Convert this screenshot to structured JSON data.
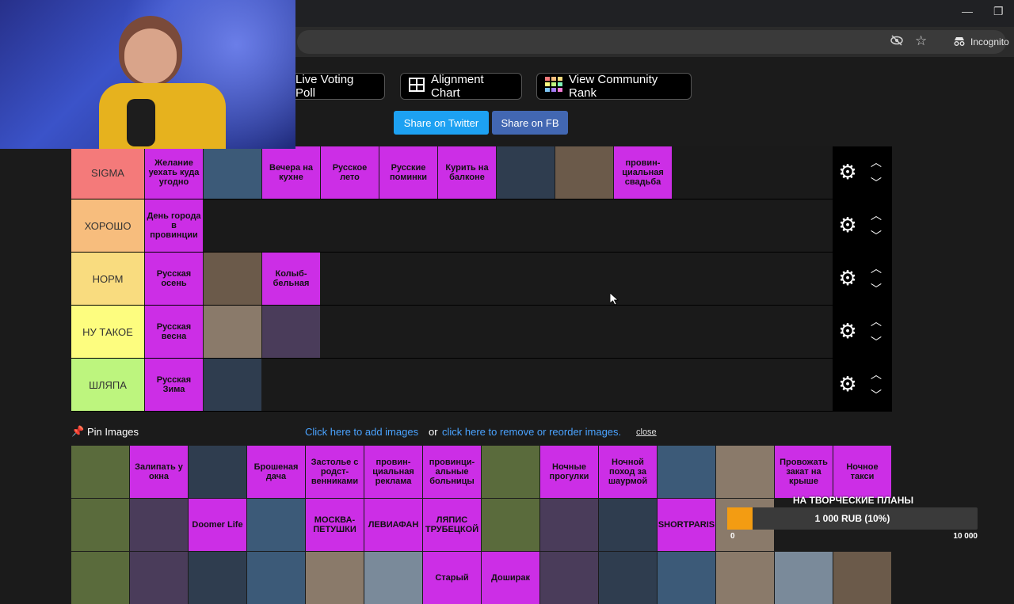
{
  "browser": {
    "incognito_label": "Incognito",
    "window_controls": [
      "—",
      "❐"
    ]
  },
  "toolbar": {
    "buttons": [
      {
        "label": "Live Voting Poll",
        "icon": "poll-icon"
      },
      {
        "label": "Alignment Chart",
        "icon": "grid-icon"
      },
      {
        "label": "View Community Rank",
        "icon": "rank-icon"
      }
    ],
    "share_twitter": "Share on Twitter",
    "share_fb": "Share on FB",
    "colors": {
      "twitter": "#1da1f2",
      "fb": "#4267b2"
    }
  },
  "tiers": [
    {
      "label": "SIGMA",
      "color": "#f47a7a",
      "items": [
        "Желание уехать куда угодно",
        "",
        "Вечера на кухне",
        "Русское лето",
        "Русские поминки",
        "Курить на балконе",
        "",
        "",
        "провин-циальная свадьба"
      ]
    },
    {
      "label": "ХОРОШО",
      "color": "#f7bd7d",
      "items": [
        "День города в провинции"
      ]
    },
    {
      "label": "НОРМ",
      "color": "#f9dc7f",
      "items": [
        "Русская осень",
        "",
        "Колыб-бельная"
      ]
    },
    {
      "label": "НУ ТАКОЕ",
      "color": "#fdfd7f",
      "items": [
        "Русская весна",
        "",
        ""
      ]
    },
    {
      "label": "ШЛЯПА",
      "color": "#bdf57e",
      "items": [
        "Русская Зима",
        ""
      ]
    }
  ],
  "pin": {
    "title": "Pin Images",
    "add_link": "Click here to add images",
    "or_text": "or",
    "remove_link": "click here to remove or reorder images.",
    "close": "close"
  },
  "pool_row1": [
    "",
    "Залипать у окна",
    "",
    "Брошеная дача",
    "Застолье с родст-венниками",
    "провин-циальная реклама",
    "провинци-альные больницы",
    "",
    "Ночные прогулки",
    "Ночной поход за шаурмой",
    "",
    "",
    "Провожать закат на крыше",
    "Ночное такси"
  ],
  "pool_row2": [
    "",
    "",
    "Doomer Life",
    "",
    "МОСКВА-ПЕТУШКИ",
    "ЛЕВИАФАН",
    "ЛЯПИС ТРУБЕЦКОЙ",
    "",
    "",
    "",
    "SHORTPARIS",
    ""
  ],
  "pool_row3": [
    "",
    "",
    "",
    "",
    "",
    "",
    "Старый",
    "Доширак",
    "",
    "",
    "",
    "",
    "",
    ""
  ],
  "donation": {
    "title": "НА ТВОРЧЕСКИЕ ПЛАНЫ",
    "amount": "1 000 RUB (10%)",
    "progress_fraction": 0.1,
    "min": "0",
    "max": "10 000"
  }
}
